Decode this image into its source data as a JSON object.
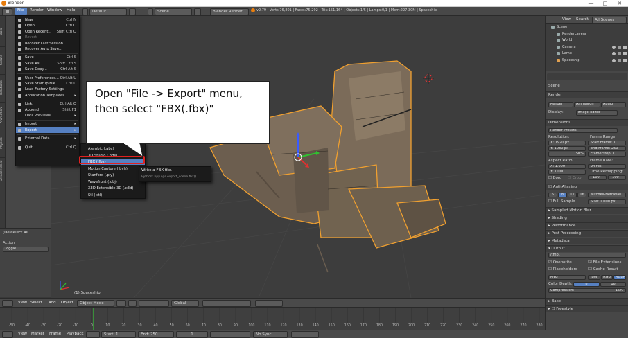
{
  "window": {
    "title": "Blender",
    "icon": "blender-logo-icon",
    "controls": [
      "—",
      "□",
      "✕"
    ]
  },
  "infobar": {
    "menus": [
      "File",
      "Render",
      "Window",
      "Help"
    ],
    "layout": "Default",
    "scene": "Scene",
    "engine": "Blender Render",
    "stats": "v2.79 | Verts:76,801 | Faces:75,292 | Tris:151,164 | Objects:1/5 | Lamps:0/1 | Mem:227.30M | Spaceship"
  },
  "file_menu": {
    "items": [
      {
        "label": "New",
        "shortcut": "Ctrl N",
        "icon": "new-file-icon"
      },
      {
        "label": "Open...",
        "shortcut": "Ctrl O",
        "icon": "folder-open-icon"
      },
      {
        "label": "Open Recent...",
        "shortcut": "Shift Ctrl O",
        "icon": "recent-icon"
      },
      {
        "label": "Revert",
        "shortcut": "",
        "icon": "revert-icon",
        "disabled": true
      },
      {
        "label": "Recover Last Session",
        "shortcut": "",
        "icon": "recover-icon"
      },
      {
        "label": "Recover Auto Save...",
        "shortcut": "",
        "icon": "recover-icon"
      },
      {
        "sep": true
      },
      {
        "label": "Save",
        "shortcut": "Ctrl S",
        "icon": "save-icon"
      },
      {
        "label": "Save As...",
        "shortcut": "Shift Ctrl S",
        "icon": "save-as-icon"
      },
      {
        "label": "Save Copy...",
        "shortcut": "Ctrl Alt S",
        "icon": "save-copy-icon"
      },
      {
        "sep": true
      },
      {
        "label": "User Preferences...",
        "shortcut": "Ctrl Alt U",
        "icon": "preferences-icon"
      },
      {
        "label": "Save Startup File",
        "shortcut": "Ctrl U",
        "icon": "save-startup-icon"
      },
      {
        "label": "Load Factory Settings",
        "shortcut": "",
        "icon": "factory-icon"
      },
      {
        "label": "Application Templates",
        "shortcut": "▸",
        "icon": "template-icon"
      },
      {
        "sep": true
      },
      {
        "label": "Link",
        "shortcut": "Ctrl Alt O",
        "icon": "link-icon"
      },
      {
        "label": "Append",
        "shortcut": "Shift F1",
        "icon": "append-icon"
      },
      {
        "label": "Data Previews",
        "shortcut": "▸",
        "icon": ""
      },
      {
        "sep": true
      },
      {
        "label": "Import",
        "shortcut": "▸",
        "icon": "import-icon"
      },
      {
        "label": "Export",
        "shortcut": "▸",
        "icon": "export-icon",
        "highlight": true
      },
      {
        "sep": true
      },
      {
        "label": "External Data",
        "shortcut": "▸",
        "icon": "external-data-icon"
      },
      {
        "sep": true
      },
      {
        "label": "Quit",
        "shortcut": "Ctrl Q",
        "icon": "quit-icon"
      }
    ]
  },
  "export_menu": {
    "items": [
      {
        "label": "Alembic (.abc)"
      },
      {
        "label": "3D Studio (.3ds)"
      },
      {
        "label": "FBX (.fbx)",
        "highlight": true
      },
      {
        "label": "Motion Capture (.bvh)"
      },
      {
        "label": "Stanford (.ply)"
      },
      {
        "label": "Wavefront (.obj)"
      },
      {
        "label": "X3D Extensible 3D (.x3d)"
      },
      {
        "label": "Stl (.stl)"
      }
    ]
  },
  "tooltip": {
    "title": "Write a FBX file.",
    "python": "Python: bpy.ops.export_scene.fbx()"
  },
  "callout": {
    "line1": "Open \"File -> Export\" menu,",
    "line2": "then select \"FBX(.fbx)\""
  },
  "left_panel": {
    "tabs": [
      "Tools",
      "Create",
      "Relations",
      "Animation",
      "Physics",
      "Grease Pencil"
    ],
    "operator": "(De)select All",
    "action_label": "Action",
    "action_value": "Toggle"
  },
  "viewport": {
    "object_label": "(1) Spaceship"
  },
  "view3d_header": {
    "menus": [
      "View",
      "Select",
      "Add",
      "Object"
    ],
    "mode": "Object Mode",
    "orientation": "Global"
  },
  "timeline": {
    "ticks": [
      "-50",
      "-40",
      "-30",
      "-20",
      "-10",
      "0",
      "10",
      "20",
      "30",
      "40",
      "50",
      "60",
      "70",
      "80",
      "90",
      "100",
      "110",
      "120",
      "130",
      "140",
      "150",
      "160",
      "170",
      "180",
      "190",
      "200",
      "210",
      "220",
      "230",
      "240",
      "250",
      "260",
      "270",
      "280"
    ],
    "footer": {
      "menus": [
        "View",
        "Marker",
        "Frame",
        "Playback"
      ],
      "start_label": "Start:",
      "start": "1",
      "end_label": "End:",
      "end": "250",
      "current": "1",
      "sync": "No Sync"
    }
  },
  "outliner": {
    "header": [
      "View",
      "Search",
      "All Scenes"
    ],
    "items": [
      {
        "label": "Scene",
        "icon": "scene-icon"
      },
      {
        "label": "RenderLayers",
        "icon": "render-layers-icon"
      },
      {
        "label": "World",
        "icon": "world-icon"
      },
      {
        "label": "Camera",
        "icon": "camera-icon"
      },
      {
        "label": "Lamp",
        "icon": "lamp-icon"
      },
      {
        "label": "Spaceship",
        "icon": "mesh-icon"
      }
    ]
  },
  "properties": {
    "breadcrumb": "Scene",
    "render_label": "Render",
    "render_buttons": [
      "Render",
      "Animation",
      "Audio"
    ],
    "display_label": "Display:",
    "display_value": "Image Editor",
    "dimensions": "Dimensions",
    "presets": "Render Presets",
    "resolution_label": "Resolution:",
    "frame_range_label": "Frame Range:",
    "res_x": "X:     1920 px",
    "res_y": "Y:     1080 px",
    "res_pct": "50%",
    "start_frame": "Start Frame:   1",
    "end_frame": "End Frame:  250",
    "frame_step": "Frame Step:   1",
    "aspect_label": "Aspect Ratio:",
    "frame_rate_label": "Frame Rate:",
    "aspect_x": "X:        1.000",
    "aspect_y": "Y:        1.000",
    "fps": "24 fps",
    "time_remap_label": "Time Remapping:",
    "remap_old": "· 100 ·",
    "remap_new": "· 100 ·",
    "border": "Bord",
    "crop": "Crop",
    "anti_aliasing": "Anti-Aliasing",
    "aa_samples": [
      "5",
      "8",
      "11",
      "16"
    ],
    "aa_filter": "Mitchell-Netravali",
    "full_sample": "Full Sample",
    "size": "Size:   1.000 px",
    "sections": [
      "Sampled Motion Blur",
      "Shading",
      "Performance",
      "Post Processing",
      "Metadata",
      "Output"
    ],
    "output_path": "/tmp\\",
    "overwrite": "Overwrite",
    "file_extensions": "File Extensions",
    "placeholders": "Placeholders",
    "cache_result": "Cache Result",
    "format": "PNG",
    "channels": [
      "BW",
      "RGB",
      "RGBA"
    ],
    "color_depth_label": "Color Depth:",
    "depth_values": [
      "8",
      "16"
    ],
    "compression": "Compression:",
    "compression_value": "15%",
    "bake": "Bake",
    "freestyle": "Freestyle"
  },
  "colors": {
    "highlight": "#5680c2",
    "outline_red": "#e02020",
    "selection_orange": "#f0a030"
  }
}
